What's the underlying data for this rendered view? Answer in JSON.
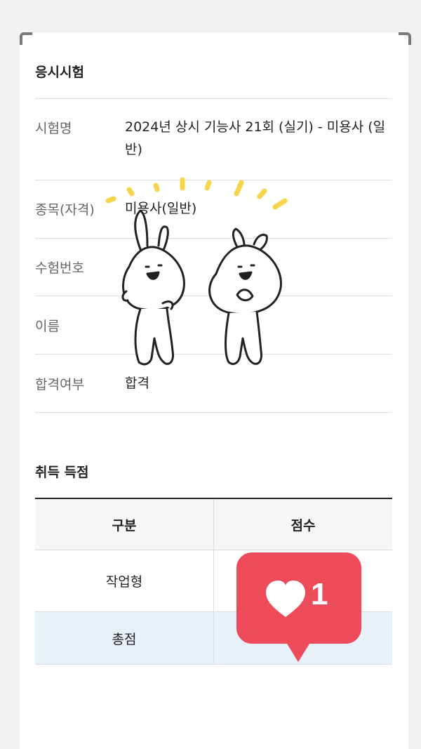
{
  "exam_section": {
    "title": "응시시험",
    "rows": [
      {
        "label": "시험명",
        "value": "2024년 상시 기능사 21회 (실기) - 미용사 (일반)"
      },
      {
        "label": "종목(자격)",
        "value": "미용사(일반)"
      },
      {
        "label": "수험번호",
        "value": ""
      },
      {
        "label": "이름",
        "value": ""
      },
      {
        "label": "합격여부",
        "value": "합격"
      }
    ]
  },
  "score_section": {
    "title": "취득 득점",
    "columns": [
      "구분",
      "점수"
    ],
    "rows": [
      {
        "category": "작업형",
        "score": ""
      },
      {
        "category": "총점",
        "score": ""
      }
    ]
  },
  "like_sticker": {
    "icon": "heart-icon",
    "count": "1",
    "color": "#ee4b5a"
  },
  "colors": {
    "total_row_bg": "#e8f0fa",
    "sparkle": "#f7d44a"
  }
}
